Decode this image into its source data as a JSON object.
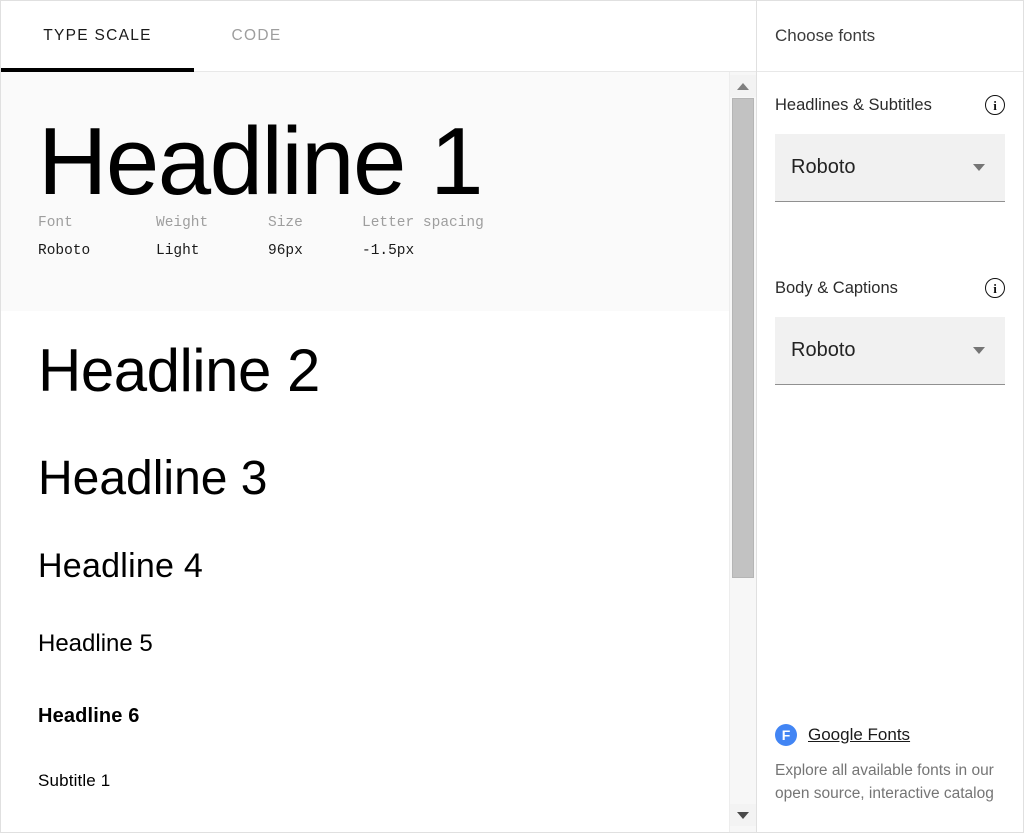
{
  "tabs": [
    {
      "label": "TYPE SCALE",
      "active": true
    },
    {
      "label": "CODE",
      "active": false
    }
  ],
  "specimens": [
    {
      "sample": "Headline 1",
      "selected": true,
      "meta": {
        "labels": {
          "font": "Font",
          "weight": "Weight",
          "size": "Size",
          "letter_spacing": "Letter spacing"
        },
        "values": {
          "font": "Roboto",
          "weight": "Light",
          "size": "96px",
          "letter_spacing": "-1.5px"
        }
      }
    },
    {
      "sample": "Headline 2",
      "selected": false
    },
    {
      "sample": "Headline 3",
      "selected": false
    },
    {
      "sample": "Headline 4",
      "selected": false
    },
    {
      "sample": "Headline 5",
      "selected": false
    },
    {
      "sample": "Headline 6",
      "selected": false
    },
    {
      "sample": "Subtitle 1",
      "selected": false
    }
  ],
  "sidebar": {
    "title": "Choose fonts",
    "fields": [
      {
        "label": "Headlines & Subtitles",
        "value": "Roboto",
        "info_glyph": "i"
      },
      {
        "label": "Body & Captions",
        "value": "Roboto",
        "info_glyph": "i"
      }
    ],
    "promo": {
      "logo_letter": "F",
      "link": "Google Fonts",
      "description": "Explore all available fonts in our open source, interactive catalog"
    }
  },
  "colors": {
    "accent_blue": "#4285F4",
    "tab_active": "#000000",
    "tab_inactive": "#9E9E9E",
    "selected_row_bg": "#FAFAFA",
    "field_bg": "#F1F1F1",
    "muted_text": "#757575"
  }
}
